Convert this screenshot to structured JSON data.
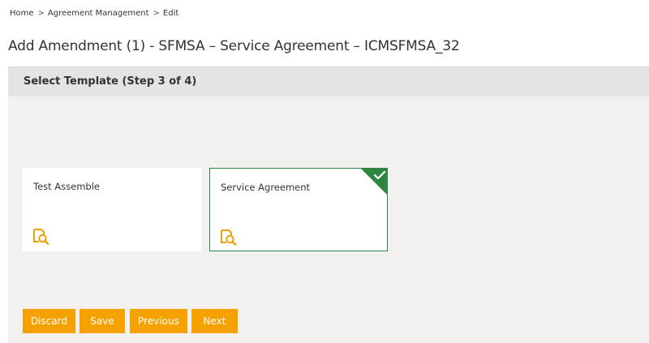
{
  "breadcrumb": {
    "items": [
      "Home",
      "Agreement Management",
      "Edit"
    ],
    "separator": ">"
  },
  "page_title": "Add Amendment (1) - SFMSA – Service Agreement – ICMSFMSA_32",
  "panel": {
    "header": "Select Template (Step 3 of 4)",
    "templates": [
      {
        "label": "Test Assemble",
        "selected": false,
        "icon": "preview-icon"
      },
      {
        "label": "Service Agreement",
        "selected": true,
        "icon": "preview-icon"
      }
    ]
  },
  "buttons": {
    "discard": "Discard",
    "save": "Save",
    "previous": "Previous",
    "next": "Next"
  },
  "colors": {
    "accent": "#f5a200",
    "selected": "#2e8540",
    "panel_bg": "#f2f1f0",
    "header_bg": "#e4e4e4"
  }
}
